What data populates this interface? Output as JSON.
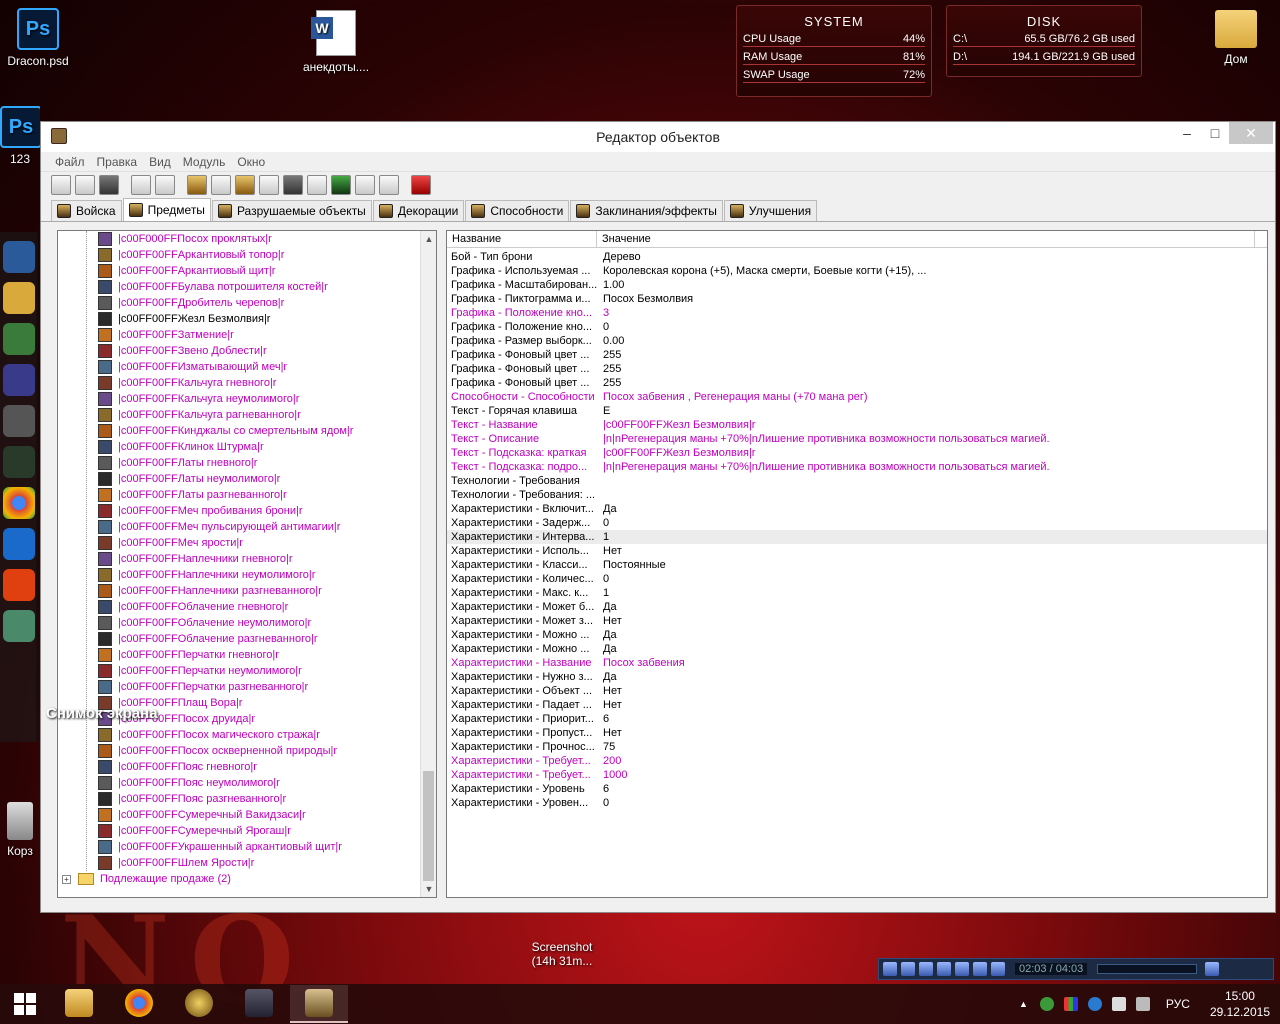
{
  "desktop": {
    "icons": [
      {
        "label": "Dracon.psd",
        "badge": "Ps"
      },
      {
        "label": "анекдоты....",
        "badge": "W"
      },
      {
        "label": "Дом"
      },
      {
        "label": "123",
        "badge": "Ps"
      },
      {
        "label": "Корз"
      },
      {
        "label": "Screenshot (14h 31m..."
      }
    ],
    "snip_label": "Снимок экрана"
  },
  "widgets": {
    "system": {
      "title": "SYSTEM",
      "rows": [
        {
          "label": "CPU Usage",
          "value": "44%"
        },
        {
          "label": "RAM Usage",
          "value": "81%"
        },
        {
          "label": "SWAP Usage",
          "value": "72%"
        }
      ]
    },
    "disk": {
      "title": "DISK",
      "rows": [
        {
          "label": "C:\\",
          "value": "65.5 GB/76.2 GB used"
        },
        {
          "label": "D:\\",
          "value": "194.1 GB/221.9 GB used"
        }
      ]
    }
  },
  "window": {
    "title": "Редактор объектов",
    "menu": [
      "Файл",
      "Правка",
      "Вид",
      "Модуль",
      "Окно"
    ],
    "tabs": [
      "Войска",
      "Предметы",
      "Разрушаемые объекты",
      "Декорации",
      "Способности",
      "Заклинания/эффекты",
      "Улучшения"
    ],
    "active_tab_index": 1,
    "tree": {
      "items": [
        "|c00F000FFПосох проклятых|r",
        "|c00FF00FFАркантиовый топор|r",
        "|c00FF00FFАркантиовый щит|r",
        "|c00FF00FFБулава потрошителя костей|r",
        "|c00FF00FFДробитель черепов|r",
        "|c00FF00FFЖезл Безмолвия|r",
        "|c00FF00FFЗатмение|r",
        "|c00FF00FFЗвено Доблести|r",
        "|c00FF00FFИзматывающий меч|r",
        "|c00FF00FFКальчуга гневного|r",
        "|c00FF00FFКальчуга неумолимого|r",
        "|c00FF00FFКальчуга рагневанного|r",
        "|c00FF00FFКинджалы со смертельным ядом|r",
        "|c00FF00FFКлинок Штурма|r",
        "|c00FF00FFЛаты гневного|r",
        "|c00FF00FFЛаты неумолимого|r",
        "|c00FF00FFЛаты разгневанного|r",
        "|c00FF00FFМеч пробивания брони|r",
        "|c00FF00FFМеч пульсирующей антимагии|r",
        "|c00FF00FFМеч ярости|r",
        "|c00FF00FFНаплечники гневного|r",
        "|c00FF00FFНаплечники неумолимого|r",
        "|c00FF00FFНаплечники разгневанного|r",
        "|c00FF00FFОблачение гневного|r",
        "|c00FF00FFОблачение неумолимого|r",
        "|c00FF00FFОблачение разгневанного|r",
        "|c00FF00FFПерчатки гневного|r",
        "|c00FF00FFПерчатки неумолимого|r",
        "|c00FF00FFПерчатки разгневанного|r",
        "|c00FF00FFПлащ Вора|r",
        "|c00FF00FFПосох друида|r",
        "|c00FF00FFПосох магического стража|r",
        "|c00FF00FFПосох оскверненной природы|r",
        "|c00FF00FFПояс гневного|r",
        "|c00FF00FFПояс неумолимого|r",
        "|c00FF00FFПояс разгневанного|r",
        "|c00FF00FFСумеречный Вакидзаси|r",
        "|c00FF00FFСумеречный Ярогаш|r",
        "|c00FF00FFУкрашенный аркантиовый щит|r",
        "|c00FF00FFШлем Ярости|r"
      ],
      "selected_index": 5,
      "folder": "Подлежащие продаже (2)"
    },
    "grid": {
      "col_name": "Название",
      "col_value": "Значение",
      "rows": [
        {
          "n": "Бой - Тип брони",
          "v": "Дерево",
          "mod": false
        },
        {
          "n": "Графика - Используемая ...",
          "v": "Королевская корона (+5), Маска смерти, Боевые когти (+15), ...",
          "mod": false
        },
        {
          "n": "Графика - Масштабирован...",
          "v": "1.00",
          "mod": false
        },
        {
          "n": "Графика - Пиктограмма и...",
          "v": "Посох Безмолвия",
          "mod": false
        },
        {
          "n": "Графика - Положение кно...",
          "v": "3",
          "mod": true
        },
        {
          "n": "Графика - Положение кно...",
          "v": "0",
          "mod": false
        },
        {
          "n": "Графика - Размер выборк...",
          "v": "0.00",
          "mod": false
        },
        {
          "n": "Графика - Фоновый цвет ...",
          "v": "255",
          "mod": false
        },
        {
          "n": "Графика - Фоновый цвет ...",
          "v": "255",
          "mod": false
        },
        {
          "n": "Графика - Фоновый цвет ...",
          "v": "255",
          "mod": false
        },
        {
          "n": "Способности - Способности",
          "v": "Посох забвения , Регенерация маны  (+70 мана рег)",
          "mod": true
        },
        {
          "n": "Текст - Горячая клавиша",
          "v": "E",
          "mod": false
        },
        {
          "n": "Текст - Название",
          "v": "|c00FF00FFЖезл Безмолвия|r",
          "mod": true
        },
        {
          "n": "Текст - Описание",
          "v": "|n|nРегенерация маны +70%|nЛишение противника возможности пользоваться магией.",
          "mod": true
        },
        {
          "n": "Текст - Подсказка: краткая",
          "v": "|c00FF00FFЖезл Безмолвия|r",
          "mod": true
        },
        {
          "n": "Текст - Подсказка: подро...",
          "v": "|n|nРегенерация маны +70%|nЛишение противника возможности пользоваться магией.",
          "mod": true
        },
        {
          "n": "Технологии - Требования",
          "v": "",
          "mod": false
        },
        {
          "n": "Технологии - Требования: ...",
          "v": "",
          "mod": false
        },
        {
          "n": "Характеристики - Включит...",
          "v": "Да",
          "mod": false
        },
        {
          "n": "Характеристики - Задерж...",
          "v": "0",
          "mod": false
        },
        {
          "n": "Характеристики - Интерва...",
          "v": "1",
          "mod": false
        },
        {
          "n": "Характеристики - Исполь...",
          "v": "Нет",
          "mod": false
        },
        {
          "n": "Характеристики - Класси...",
          "v": "Постоянные",
          "mod": false
        },
        {
          "n": "Характеристики - Количес...",
          "v": "0",
          "mod": false
        },
        {
          "n": "Характеристики - Макс. к...",
          "v": "1",
          "mod": false
        },
        {
          "n": "Характеристики - Может б...",
          "v": "Да",
          "mod": false
        },
        {
          "n": "Характеристики - Может з...",
          "v": "Нет",
          "mod": false
        },
        {
          "n": "Характеристики - Можно ...",
          "v": "Да",
          "mod": false
        },
        {
          "n": "Характеристики - Можно ...",
          "v": "Да",
          "mod": false
        },
        {
          "n": "Характеристики - Название",
          "v": "Посох забвения",
          "mod": true
        },
        {
          "n": "Характеристики - Нужно з...",
          "v": "Да",
          "mod": false
        },
        {
          "n": "Характеристики - Объект ...",
          "v": "Нет",
          "mod": false
        },
        {
          "n": "Характеристики - Падает ...",
          "v": "Нет",
          "mod": false
        },
        {
          "n": "Характеристики - Приорит...",
          "v": "6",
          "mod": false
        },
        {
          "n": "Характеристики - Пропуст...",
          "v": "Нет",
          "mod": false
        },
        {
          "n": "Характеристики - Прочнос...",
          "v": "75",
          "mod": false
        },
        {
          "n": "Характеристики - Требует...",
          "v": "200",
          "mod": true
        },
        {
          "n": "Характеристики - Требует...",
          "v": "1000",
          "mod": true
        },
        {
          "n": "Характеристики - Уровень",
          "v": "6",
          "mod": false
        },
        {
          "n": "Характеристики - Уровен...",
          "v": "0",
          "mod": false
        }
      ],
      "highlight_index": 20
    }
  },
  "player": {
    "time": "02:03 / 04:03"
  },
  "taskbar": {
    "lang": "РУС",
    "time": "15:00",
    "date": "29.12.2015"
  },
  "colors": {
    "modified_text": "#c000c0",
    "accent_red": "#c0141a"
  }
}
